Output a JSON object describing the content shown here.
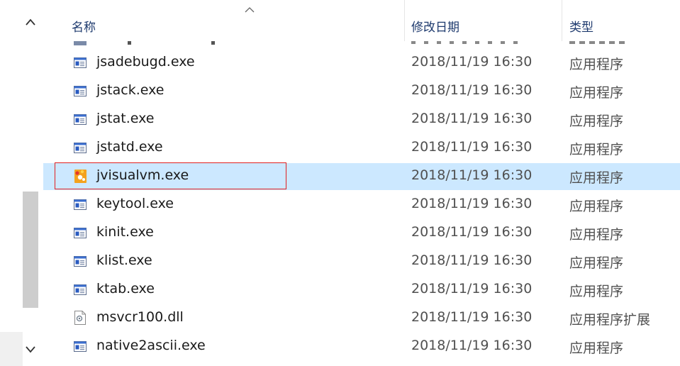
{
  "header": {
    "name_label": "名称",
    "date_label": "修改日期",
    "type_label": "类型"
  },
  "files": [
    {
      "name": "jsadebugd.exe",
      "date": "2018/11/19 16:30",
      "type": "应用程序",
      "icon": "app-window-icon",
      "selected": false
    },
    {
      "name": "jstack.exe",
      "date": "2018/11/19 16:30",
      "type": "应用程序",
      "icon": "app-window-icon",
      "selected": false
    },
    {
      "name": "jstat.exe",
      "date": "2018/11/19 16:30",
      "type": "应用程序",
      "icon": "app-window-icon",
      "selected": false
    },
    {
      "name": "jstatd.exe",
      "date": "2018/11/19 16:30",
      "type": "应用程序",
      "icon": "app-window-icon",
      "selected": false
    },
    {
      "name": "jvisualvm.exe",
      "date": "2018/11/19 16:30",
      "type": "应用程序",
      "icon": "jvisualvm-icon",
      "selected": true
    },
    {
      "name": "keytool.exe",
      "date": "2018/11/19 16:30",
      "type": "应用程序",
      "icon": "app-window-icon",
      "selected": false
    },
    {
      "name": "kinit.exe",
      "date": "2018/11/19 16:30",
      "type": "应用程序",
      "icon": "app-window-icon",
      "selected": false
    },
    {
      "name": "klist.exe",
      "date": "2018/11/19 16:30",
      "type": "应用程序",
      "icon": "app-window-icon",
      "selected": false
    },
    {
      "name": "ktab.exe",
      "date": "2018/11/19 16:30",
      "type": "应用程序",
      "icon": "app-window-icon",
      "selected": false
    },
    {
      "name": "msvcr100.dll",
      "date": "2018/11/19 16:30",
      "type": "应用程序扩展",
      "icon": "dll-file-icon",
      "selected": false
    },
    {
      "name": "native2ascii.exe",
      "date": "2018/11/19 16:30",
      "type": "应用程序",
      "icon": "app-window-icon",
      "selected": false
    }
  ],
  "colors": {
    "selection_bg": "#cce8ff",
    "highlight_border": "#e02020",
    "header_text": "#1e3a6e"
  }
}
